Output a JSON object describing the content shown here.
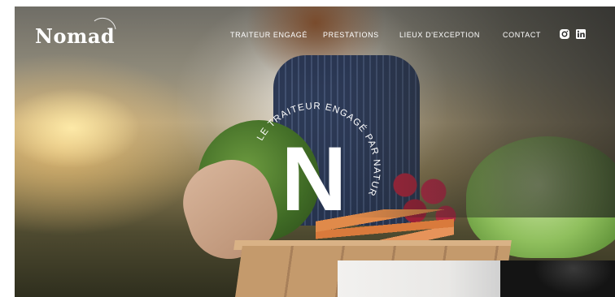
{
  "header": {
    "logo_text": "Nomad",
    "nav": [
      {
        "label": "TRAITEUR ENGAGÉ"
      },
      {
        "label": "PRESTATIONS"
      },
      {
        "label": "LIEUX D'EXCEPTION"
      },
      {
        "label": "CONTACT"
      }
    ],
    "social": [
      {
        "icon": "instagram-icon"
      },
      {
        "icon": "linkedin-icon"
      }
    ]
  },
  "hero": {
    "emblem_letter": "N",
    "emblem_arc_text": "LE TRAITEUR ENGAGÉ PAR NATURE"
  },
  "colors": {
    "text_on_image": "#ffffff",
    "apron_blue": "#23314f",
    "beet_red": "#a3243c",
    "cabbage_green": "#8fbf5d"
  }
}
